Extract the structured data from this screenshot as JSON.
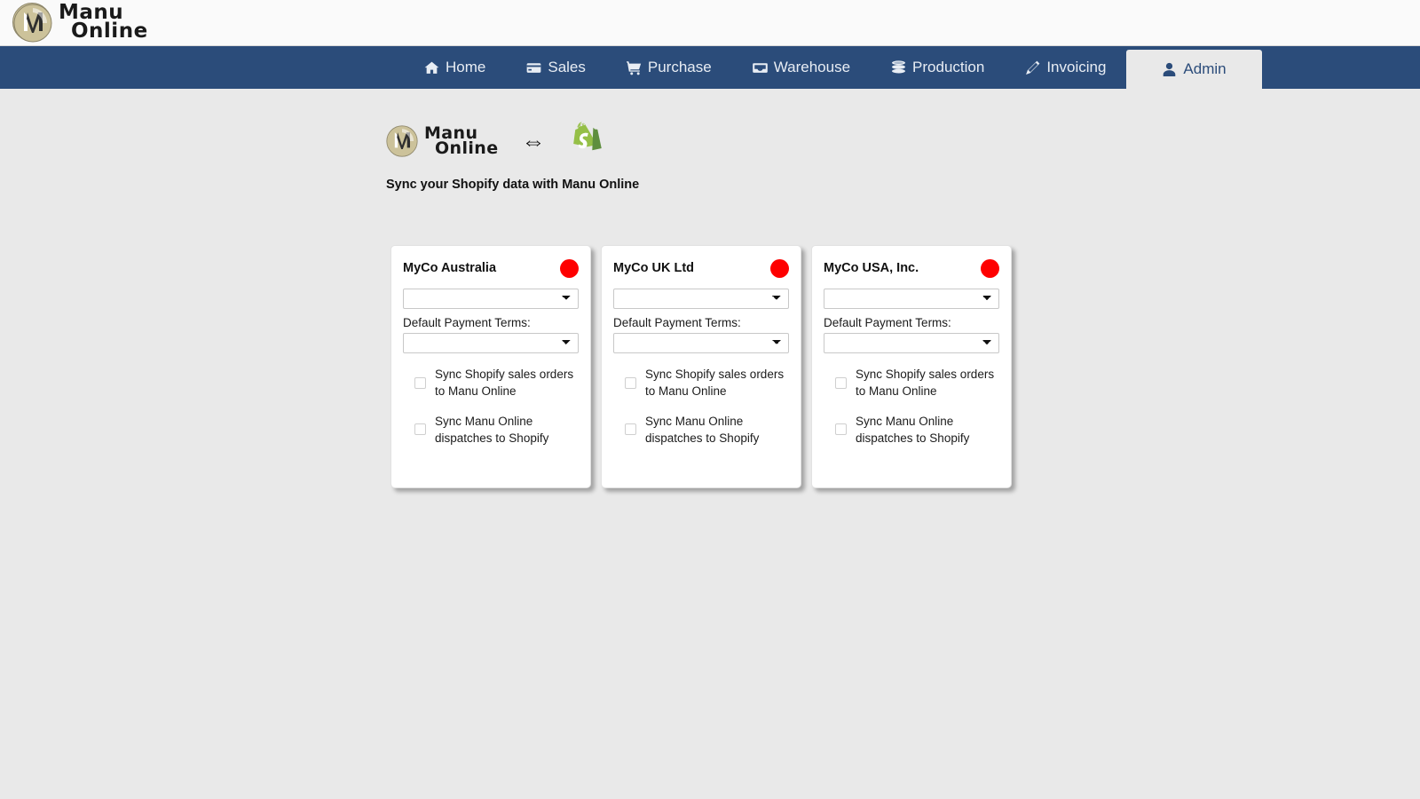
{
  "brand": {
    "logo_icon": "manu-online-logo",
    "name_line1": "Manu",
    "name_line2": "Online"
  },
  "nav": {
    "items": [
      {
        "label": "Home",
        "icon": "home-icon",
        "active": false
      },
      {
        "label": "Sales",
        "icon": "credit-card-icon",
        "active": false
      },
      {
        "label": "Purchase",
        "icon": "cart-icon",
        "active": false
      },
      {
        "label": "Warehouse",
        "icon": "inbox-icon",
        "active": false
      },
      {
        "label": "Production",
        "icon": "database-icon",
        "active": false
      },
      {
        "label": "Invoicing",
        "icon": "invoice-icon",
        "active": false
      },
      {
        "label": "Admin",
        "icon": "user-icon",
        "active": true
      }
    ],
    "bar_color": "#2b4c7a",
    "active_bg": "#e9e9e9",
    "active_text": "#2b4c7a"
  },
  "sync_header": {
    "left_logo_icon": "manu-online-logo",
    "left_logo_line1": "Manu",
    "left_logo_line2": "Online",
    "swap_icon": "left-right-arrow-icon",
    "swap_glyph": "⇔",
    "right_logo_icon": "shopify-logo-icon",
    "shopify_color": "#95bf47",
    "caption": "Sync your Shopify data with Manu Online"
  },
  "cards": [
    {
      "title": "MyCo Australia",
      "status_color": "#fe0000",
      "status_label": "disconnected",
      "store_select_value": "",
      "store_select_options": [
        ""
      ],
      "terms_label": "Default Payment Terms:",
      "terms_select_value": "",
      "terms_select_options": [
        ""
      ],
      "checkboxes": [
        {
          "label": "Sync Shopify sales orders to Manu Online",
          "checked": false
        },
        {
          "label": "Sync Manu Online dispatches to Shopify",
          "checked": false
        }
      ]
    },
    {
      "title": "MyCo UK Ltd",
      "status_color": "#fe0000",
      "status_label": "disconnected",
      "store_select_value": "",
      "store_select_options": [
        ""
      ],
      "terms_label": "Default Payment Terms:",
      "terms_select_value": "",
      "terms_select_options": [
        ""
      ],
      "checkboxes": [
        {
          "label": "Sync Shopify sales orders to Manu Online",
          "checked": false
        },
        {
          "label": "Sync Manu Online dispatches to Shopify",
          "checked": false
        }
      ]
    },
    {
      "title": "MyCo USA, Inc.",
      "status_color": "#fe0000",
      "status_label": "disconnected",
      "store_select_value": "",
      "store_select_options": [
        ""
      ],
      "terms_label": "Default Payment Terms:",
      "terms_select_value": "",
      "terms_select_options": [
        ""
      ],
      "checkboxes": [
        {
          "label": "Sync Shopify sales orders to Manu Online",
          "checked": false
        },
        {
          "label": "Sync Manu Online dispatches to Shopify",
          "checked": false
        }
      ]
    }
  ]
}
